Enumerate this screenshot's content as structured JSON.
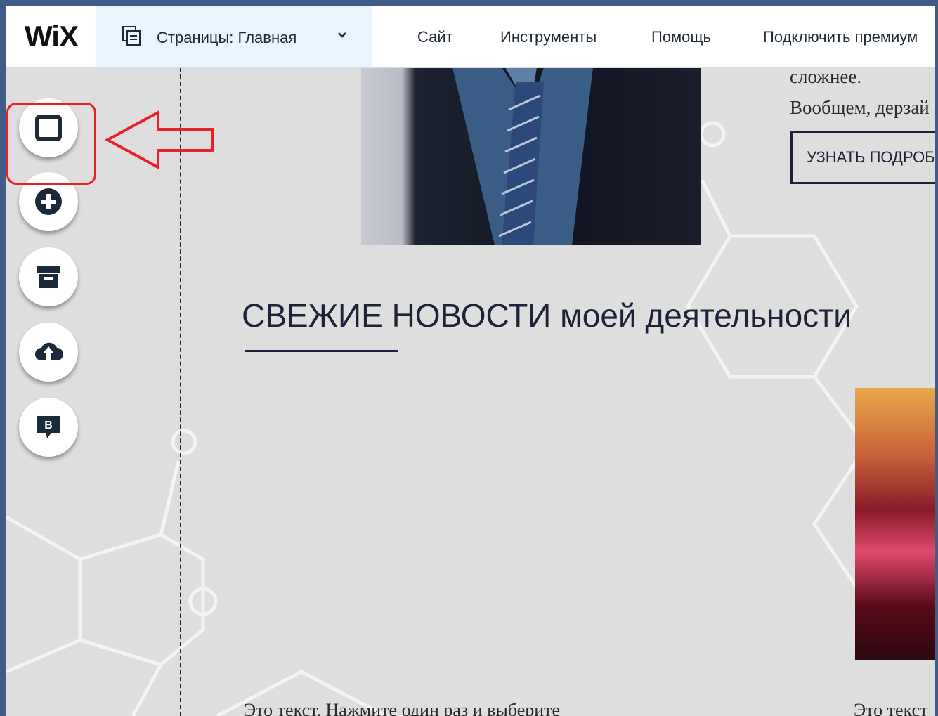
{
  "topbar": {
    "logo": "WiX",
    "pages_label": "Страницы: Главная",
    "menu": [
      "Сайт",
      "Инструменты",
      "Помощь",
      "Подключить премиум"
    ]
  },
  "sidebar": {
    "buttons": [
      {
        "name": "background",
        "icon": "square-icon"
      },
      {
        "name": "add",
        "icon": "plus-circle-icon"
      },
      {
        "name": "app-market",
        "icon": "store-icon"
      },
      {
        "name": "upload",
        "icon": "cloud-upload-icon"
      },
      {
        "name": "blog",
        "icon": "blog-b-icon"
      }
    ]
  },
  "content": {
    "text_line1": "сложнее.",
    "text_line2": "Вообщем, дерзай",
    "learn_more": "УЗНАТЬ ПОДРОБНЕЕ",
    "heading": "СВЕЖИЕ НОВОСТИ моей деятельности",
    "body_left": "Это текст. Нажмите один раз и выберите",
    "body_right": "Это текст"
  },
  "colors": {
    "accent_red": "#e8202a",
    "navy": "#1c2238",
    "pages_bg": "#eaf4fd"
  }
}
